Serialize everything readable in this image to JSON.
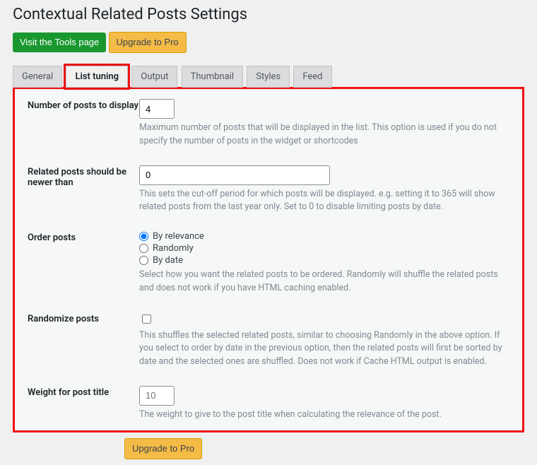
{
  "header": {
    "title": "Contextual Related Posts Settings"
  },
  "buttons": {
    "visit_tools": "Visit the Tools page",
    "upgrade": "Upgrade to Pro"
  },
  "tabs": {
    "general": "General",
    "list_tuning": "List tuning",
    "output": "Output",
    "thumbnail": "Thumbnail",
    "styles": "Styles",
    "feed": "Feed"
  },
  "fields": {
    "num_posts": {
      "label": "Number of posts to display",
      "value": "4",
      "desc": "Maximum number of posts that will be displayed in the list. This option is used if you do not specify the number of posts in the widget or shortcodes"
    },
    "newer_than": {
      "label": "Related posts should be newer than",
      "value": "0",
      "desc": "This sets the cut-off period for which posts will be displayed. e.g. setting it to 365 will show related posts from the last year only. Set to 0 to disable limiting posts by date."
    },
    "order": {
      "label": "Order posts",
      "relevance": "By relevance",
      "randomly": "Randomly",
      "by_date": "By date",
      "desc": "Select how you want the related posts to be ordered. Randomly will shuffle the related posts and does not work if you have HTML caching enabled."
    },
    "randomize": {
      "label": "Randomize posts",
      "desc": "This shuffles the selected related posts, similar to choosing Randomly in the above option. If you select to order by date in the previous option, then the related posts will first be sorted by date and the selected ones are shuffled. Does not work if Cache HTML output is enabled."
    },
    "weight_title": {
      "label": "Weight for post title",
      "placeholder": "10",
      "desc": "The weight to give to the post title when calculating the relevance of the post."
    }
  }
}
